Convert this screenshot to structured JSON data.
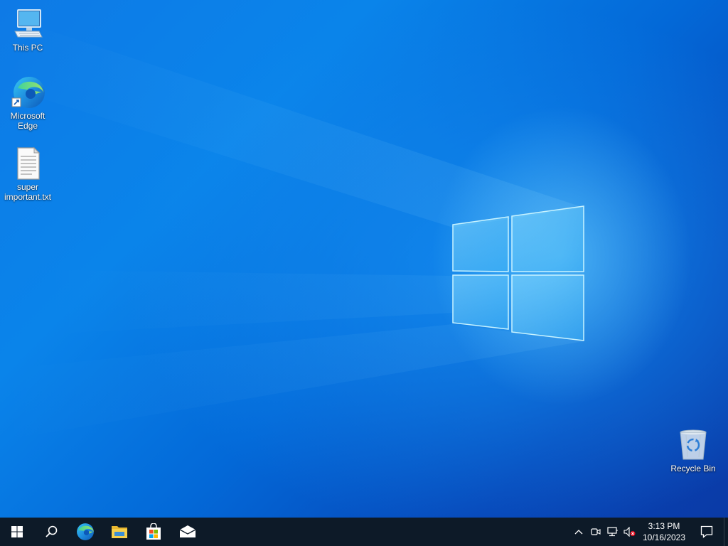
{
  "desktop": {
    "icons": [
      {
        "label": "This PC",
        "icon": "computer-icon"
      },
      {
        "label": "Microsoft Edge",
        "icon": "edge-icon"
      },
      {
        "label": "super important.txt",
        "icon": "text-file-icon"
      },
      {
        "label": "Recycle Bin",
        "icon": "recycle-bin-icon"
      }
    ]
  },
  "taskbar": {
    "start": {
      "icon": "windows-icon"
    },
    "search": {
      "icon": "search-icon"
    },
    "pinned": [
      {
        "name": "Microsoft Edge",
        "icon": "edge-icon"
      },
      {
        "name": "File Explorer",
        "icon": "folder-icon"
      },
      {
        "name": "Microsoft Store",
        "icon": "store-icon"
      },
      {
        "name": "Mail",
        "icon": "mail-icon"
      }
    ],
    "tray": {
      "icons": [
        "chevron-up-icon",
        "meet-now-icon",
        "network-icon",
        "volume-muted-icon"
      ],
      "time": "3:13 PM",
      "date": "10/16/2023",
      "notification_icon": "action-center-icon"
    }
  },
  "colors": {
    "taskbar": "#0d1a28",
    "wallpaper_accent": "#0a84ea"
  }
}
